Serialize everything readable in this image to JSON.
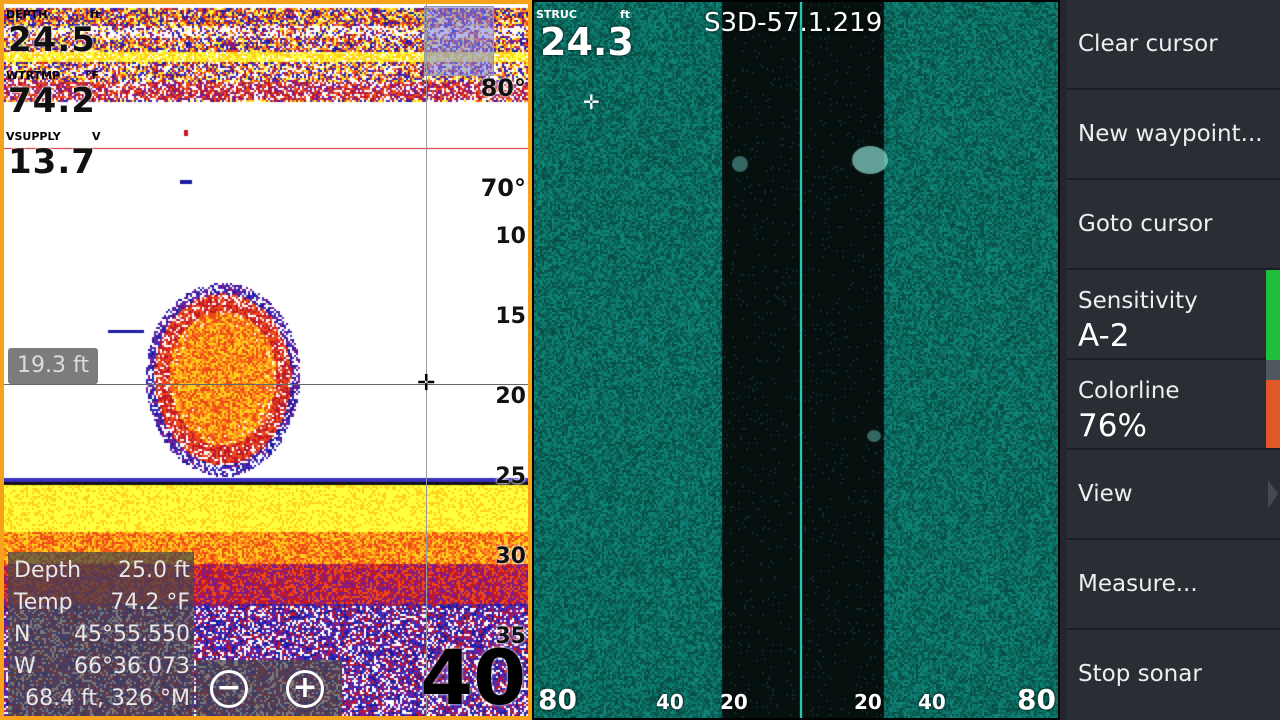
{
  "sonar": {
    "depth_label": "DEPTH",
    "depth_unit": "ft",
    "depth_value": "24.5",
    "water_temp_label": "WTRTMP",
    "water_temp_unit": "°F",
    "water_temp_value": "74.2",
    "vsupply_label": "VSUPPLY",
    "vsupply_unit": "V",
    "vsupply_value": "13.7",
    "temp_marks": [
      "80°",
      "70°"
    ],
    "depth_scale": [
      "10",
      "15",
      "20",
      "25",
      "30",
      "35"
    ],
    "range": "40",
    "cursor_depth": "19.3 ft",
    "zoom_out": "−",
    "zoom_in": "+"
  },
  "info": {
    "rows": [
      {
        "key": "Depth",
        "value": "25.0  ft"
      },
      {
        "key": "Temp",
        "value": "74.2 °F"
      },
      {
        "key": "N",
        "value": "45°55.550"
      },
      {
        "key": "W",
        "value": "66°36.073"
      },
      {
        "key": "",
        "value": "68.4 ft, 326 °M"
      }
    ]
  },
  "sidescan": {
    "struc_label": "STRUC",
    "struc_unit": "ft",
    "struc_value": "24.3",
    "title": "S3D-57.1.219",
    "range_labels": [
      "80",
      "40",
      "20",
      "20",
      "40",
      "80"
    ]
  },
  "menu": {
    "items": [
      {
        "label": "Clear cursor",
        "value": ""
      },
      {
        "label": "New waypoint...",
        "value": ""
      },
      {
        "label": "Goto cursor",
        "value": ""
      },
      {
        "label": "Sensitivity",
        "value": "A-2",
        "accent": "#1fbe3c"
      },
      {
        "label": "Colorline",
        "value": "76%",
        "accent": "#e0572a"
      },
      {
        "label": "View",
        "value": ""
      },
      {
        "label": "Measure...",
        "value": ""
      },
      {
        "label": "Stop sonar",
        "value": ""
      }
    ]
  },
  "colors": {
    "frame": "#f7a21b",
    "scan_water": "#0a0d0d",
    "scan_bottom": "#1e9a92"
  }
}
